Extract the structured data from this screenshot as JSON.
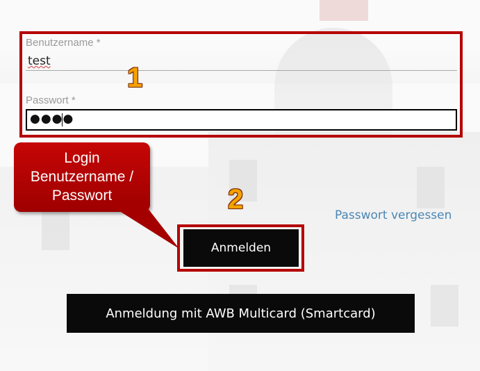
{
  "form": {
    "username_label": "Benutzername *",
    "username_value": "test",
    "password_label": "Passwort *",
    "password_masked": "●●●●"
  },
  "actions": {
    "forgot_password": "Passwort vergessen",
    "login_button": "Anmelden",
    "smartcard_button": "Anmeldung mit AWB Multicard (Smartcard)"
  },
  "annotations": {
    "step1": "1",
    "step2": "2",
    "callout_line1": "Login",
    "callout_line2": "Benutzername /",
    "callout_line3": "Passwort"
  },
  "colors": {
    "annotation_red": "#b50000",
    "step_number_orange": "#f5a100",
    "link_blue": "#4a86b4",
    "button_bg": "#0a0a0a"
  }
}
